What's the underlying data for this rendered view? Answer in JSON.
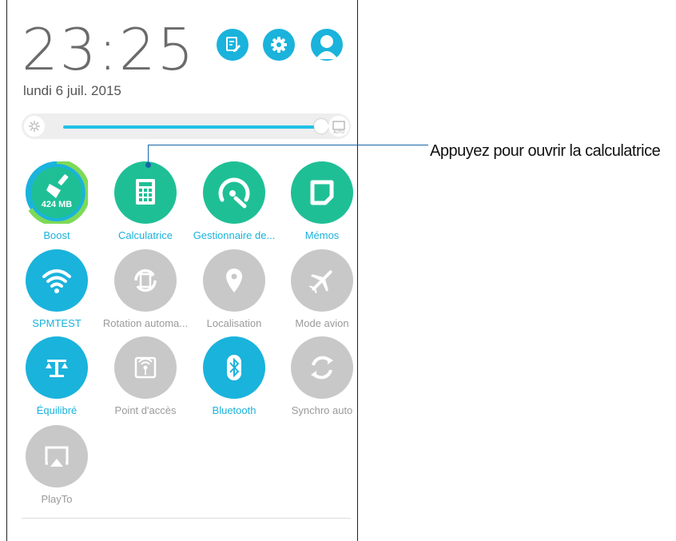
{
  "status": {
    "time": "23:25",
    "date": "lundi 6 juil. 2015"
  },
  "header": {
    "buttons": [
      {
        "name": "edit-icon"
      },
      {
        "name": "gear-icon"
      },
      {
        "name": "avatar-icon"
      }
    ]
  },
  "brightness": {
    "level": 0.98,
    "auto_label": "AUTO"
  },
  "tiles": [
    {
      "label": "Boost",
      "badge": "424 MB",
      "state": "on",
      "icon": "broom-icon"
    },
    {
      "label": "Calculatrice",
      "state": "on",
      "icon": "calculator-icon"
    },
    {
      "label": "Gestionnaire de...",
      "state": "on",
      "icon": "speedometer-wrench-icon"
    },
    {
      "label": "Mémos",
      "state": "on",
      "icon": "memo-icon"
    },
    {
      "label": "SPMTEST",
      "state": "on",
      "icon": "wifi-icon"
    },
    {
      "label": "Rotation automa...",
      "state": "off",
      "icon": "rotation-icon"
    },
    {
      "label": "Localisation",
      "state": "off",
      "icon": "location-pin-icon"
    },
    {
      "label": "Mode avion",
      "state": "off",
      "icon": "airplane-icon"
    },
    {
      "label": "Équilibré",
      "state": "on",
      "icon": "balance-icon"
    },
    {
      "label": "Point d'accès",
      "state": "off",
      "icon": "hotspot-icon"
    },
    {
      "label": "Bluetooth",
      "state": "on",
      "icon": "bluetooth-icon"
    },
    {
      "label": "Synchro auto",
      "state": "off",
      "icon": "sync-icon"
    },
    {
      "label": "PlayTo",
      "state": "off",
      "icon": "playto-icon"
    }
  ],
  "callout": {
    "text": "Appuyez pour ouvrir la calculatrice"
  },
  "colors": {
    "accent": "#1ab3dc",
    "green": "#1fbf96",
    "off": "#c8c8c8",
    "callout": "#1565a8"
  }
}
